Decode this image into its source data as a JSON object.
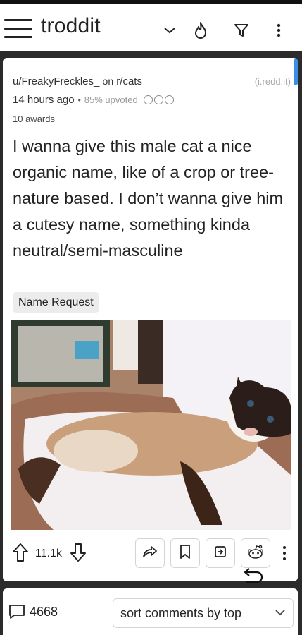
{
  "app": {
    "title": "troddit"
  },
  "toolbar": {
    "icons": [
      "menu-icon",
      "chevron-down-icon",
      "flame-icon",
      "filter-icon",
      "more-vertical-icon"
    ]
  },
  "post": {
    "author": "u/FreakyFreckles_",
    "on_label": "on",
    "subreddit": "r/cats",
    "source": "(i.redd.it)",
    "time": "14 hours ago",
    "upvoted": "85% upvoted",
    "awards": "10 awards",
    "title": "I wanna give this male cat a nice organic name, like of a crop or tree- nature based. I don’t wanna give him a cutesy name, something kinda neutral/semi-masculine",
    "flair": "Name Request",
    "image_alt": "Siamese cat lying on a white blanket",
    "score": "11.1k"
  },
  "actions": {
    "icons": [
      "share-icon",
      "save-icon",
      "open-external-icon",
      "reddit-icon",
      "more-vertical-icon"
    ]
  },
  "comments": {
    "count": "4668",
    "sort_label": "sort comments by top"
  }
}
